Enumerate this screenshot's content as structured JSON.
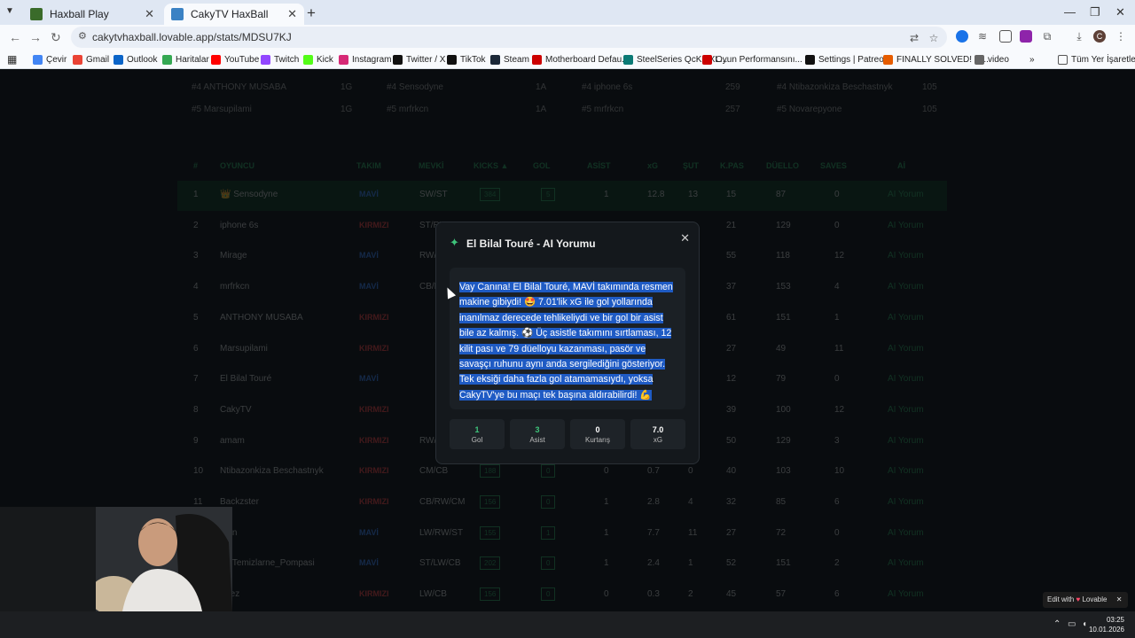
{
  "browser": {
    "tabs": [
      {
        "title": "Haxball Play",
        "favicon_color": "#3a6b2a"
      },
      {
        "title": "CakyTV HaxBall",
        "favicon_color": "#3b82c4"
      }
    ],
    "url": "cakytvhaxball.lovable.app/stats/MDSU7KJ",
    "bookmarks": [
      {
        "label": "Çevir",
        "color": "#4285f4"
      },
      {
        "label": "Gmail",
        "color": "#ea4335"
      },
      {
        "label": "Outlook",
        "color": "#0a64c8"
      },
      {
        "label": "Haritalar",
        "color": "#34a853"
      },
      {
        "label": "YouTube",
        "color": "#ff0000"
      },
      {
        "label": "Twitch",
        "color": "#9146ff"
      },
      {
        "label": "Kick",
        "color": "#53fc18"
      },
      {
        "label": "Instagram",
        "color": "#d62976"
      },
      {
        "label": "Twitter / X",
        "color": "#111111"
      },
      {
        "label": "TikTok",
        "color": "#111111"
      },
      {
        "label": "Steam",
        "color": "#1b2838"
      },
      {
        "label": "Motherboard Defau...",
        "color": "#cc0000"
      },
      {
        "label": "SteelSeries QcK 3XL...",
        "color": "#0b7a75"
      },
      {
        "label": "Oyun Performansını...",
        "color": "#cc0000"
      },
      {
        "label": "Settings | Patreon",
        "color": "#111111"
      },
      {
        "label": "FINALLY SOLVED! G...",
        "color": "#e65c00"
      },
      {
        "label": "video",
        "color": "#666666"
      }
    ],
    "all_bookmarks": "Tüm Yer İşaretleri"
  },
  "summary": [
    {
      "cells": [
        "#4 ANTHONY MUSABA",
        "1G",
        "#4 Sensodyne",
        "1A",
        "#4 iphone 6s",
        "259",
        "#4 Ntibazonkiza Beschastnyk",
        "105"
      ]
    },
    {
      "cells": [
        "#5 Marsupilami",
        "1G",
        "#5 mrfrkcn",
        "1A",
        "#5 mrfrkcn",
        "257",
        "#5 Novarepyone",
        "105"
      ]
    }
  ],
  "table": {
    "headers": [
      "#",
      "OYUNCU",
      "TAKIM",
      "MEVKİ",
      "KICKS ▲",
      "GOL",
      "ASİST",
      "xG",
      "ŞUT",
      "K.PAS",
      "DÜELLO",
      "SAVES",
      "Aİ"
    ],
    "rows": [
      {
        "n": "1",
        "name": "👑 Sensodyne",
        "team": "MAVİ",
        "pos": "SW/ST",
        "kicks": "384",
        "gol": "5",
        "asist": "1",
        "xg": "12.8",
        "sut": "13",
        "kpas": "15",
        "duello": "87",
        "saves": "0",
        "ai": "AI Yorum"
      },
      {
        "n": "2",
        "name": "iphone 6s",
        "team": "KIRMIZI",
        "pos": "ST/RW",
        "kicks": "",
        "gol": "",
        "asist": "",
        "xg": "",
        "sut": "",
        "kpas": "21",
        "duello": "129",
        "saves": "0",
        "ai": "AI Yorum"
      },
      {
        "n": "3",
        "name": "Mirage",
        "team": "MAVİ",
        "pos": "RW/CM",
        "kicks": "",
        "gol": "",
        "asist": "",
        "xg": "",
        "sut": "",
        "kpas": "55",
        "duello": "118",
        "saves": "12",
        "ai": "AI Yorum"
      },
      {
        "n": "4",
        "name": "mrfrkcn",
        "team": "MAVİ",
        "pos": "CB/RW",
        "kicks": "",
        "gol": "",
        "asist": "",
        "xg": "",
        "sut": "",
        "kpas": "37",
        "duello": "153",
        "saves": "4",
        "ai": "AI Yorum"
      },
      {
        "n": "5",
        "name": "ANTHONY MUSABA",
        "team": "KIRMIZI",
        "pos": "",
        "kicks": "",
        "gol": "",
        "asist": "",
        "xg": "",
        "sut": "",
        "kpas": "61",
        "duello": "151",
        "saves": "1",
        "ai": "AI Yorum"
      },
      {
        "n": "6",
        "name": "Marsupilami",
        "team": "KIRMIZI",
        "pos": "",
        "kicks": "",
        "gol": "",
        "asist": "",
        "xg": "",
        "sut": "",
        "kpas": "27",
        "duello": "49",
        "saves": "11",
        "ai": "AI Yorum"
      },
      {
        "n": "7",
        "name": "El Bilal Touré",
        "team": "MAVİ",
        "pos": "",
        "kicks": "",
        "gol": "",
        "asist": "",
        "xg": "",
        "sut": "",
        "kpas": "12",
        "duello": "79",
        "saves": "0",
        "ai": "AI Yorum"
      },
      {
        "n": "8",
        "name": "CakyTV",
        "team": "KIRMIZI",
        "pos": "",
        "kicks": "",
        "gol": "",
        "asist": "",
        "xg": "",
        "sut": "",
        "kpas": "39",
        "duello": "100",
        "saves": "12",
        "ai": "AI Yorum"
      },
      {
        "n": "9",
        "name": "amam",
        "team": "KIRMIZI",
        "pos": "RW/ST",
        "kicks": "",
        "gol": "",
        "asist": "",
        "xg": "",
        "sut": "",
        "kpas": "50",
        "duello": "129",
        "saves": "3",
        "ai": "AI Yorum"
      },
      {
        "n": "10",
        "name": "Ntibazonkiza Beschastnyk",
        "team": "KIRMIZI",
        "pos": "CM/CB",
        "kicks": "188",
        "gol": "0",
        "asist": "0",
        "xg": "0.7",
        "sut": "0",
        "kpas": "40",
        "duello": "103",
        "saves": "10",
        "ai": "AI Yorum"
      },
      {
        "n": "11",
        "name": "Backzster",
        "team": "KIRMIZI",
        "pos": "CB/RW/CM",
        "kicks": "156",
        "gol": "0",
        "asist": "1",
        "xg": "2.8",
        "sut": "4",
        "kpas": "32",
        "duello": "85",
        "saves": "6",
        "ai": "AI Yorum"
      },
      {
        "n": "12",
        "name": "...an",
        "team": "MAVİ",
        "pos": "LW/RW/ST",
        "kicks": "155",
        "gol": "1",
        "asist": "1",
        "xg": "7.7",
        "sut": "11",
        "kpas": "27",
        "duello": "72",
        "saves": "0",
        "ai": "AI Yorum"
      },
      {
        "n": "13",
        "name": "..._Temizlarne_Pompasi",
        "team": "MAVİ",
        "pos": "ST/LW/CB",
        "kicks": "202",
        "gol": "0",
        "asist": "1",
        "xg": "2.4",
        "sut": "1",
        "kpas": "52",
        "duello": "151",
        "saves": "2",
        "ai": "AI Yorum"
      },
      {
        "n": "14",
        "name": "...rez",
        "team": "KIRMIZI",
        "pos": "LW/CB",
        "kicks": "156",
        "gol": "0",
        "asist": "0",
        "xg": "0.3",
        "sut": "2",
        "kpas": "45",
        "duello": "57",
        "saves": "6",
        "ai": "AI Yorum"
      }
    ]
  },
  "modal": {
    "title": "El Bilal Touré - AI Yorumu",
    "text": "Vay Canına! El Bilal Touré, MAVİ takımında resmen makine gibiydi! 🤩 7.01'lik xG ile gol yollarında inanılmaz derecede tehlikeliydi ve bir gol bir asist bile az kalmış. ⚽ Üç asistle takımını sırtlaması, 12 kilit pası ve 79 düelloyu kazanması, pasör ve savaşçı ruhunu aynı anda sergilediğini gösteriyor. Tek eksiği daha fazla gol atamamasıydı, yoksa CakyTV'ye bu maçı tek başına aldırabilirdi! 💪",
    "stats": [
      {
        "value": "1",
        "label": "Gol",
        "color": "#3ec47a"
      },
      {
        "value": "3",
        "label": "Asist",
        "color": "#3ec47a"
      },
      {
        "value": "0",
        "label": "Kurtarış",
        "color": "#ffffff"
      },
      {
        "value": "7.0",
        "label": "xG",
        "color": "#ffffff"
      }
    ]
  },
  "edit_badge": {
    "prefix": "Edit with",
    "brand": "Lovable"
  },
  "taskbar": {
    "time": "03:25",
    "date": "10.01.2026"
  }
}
